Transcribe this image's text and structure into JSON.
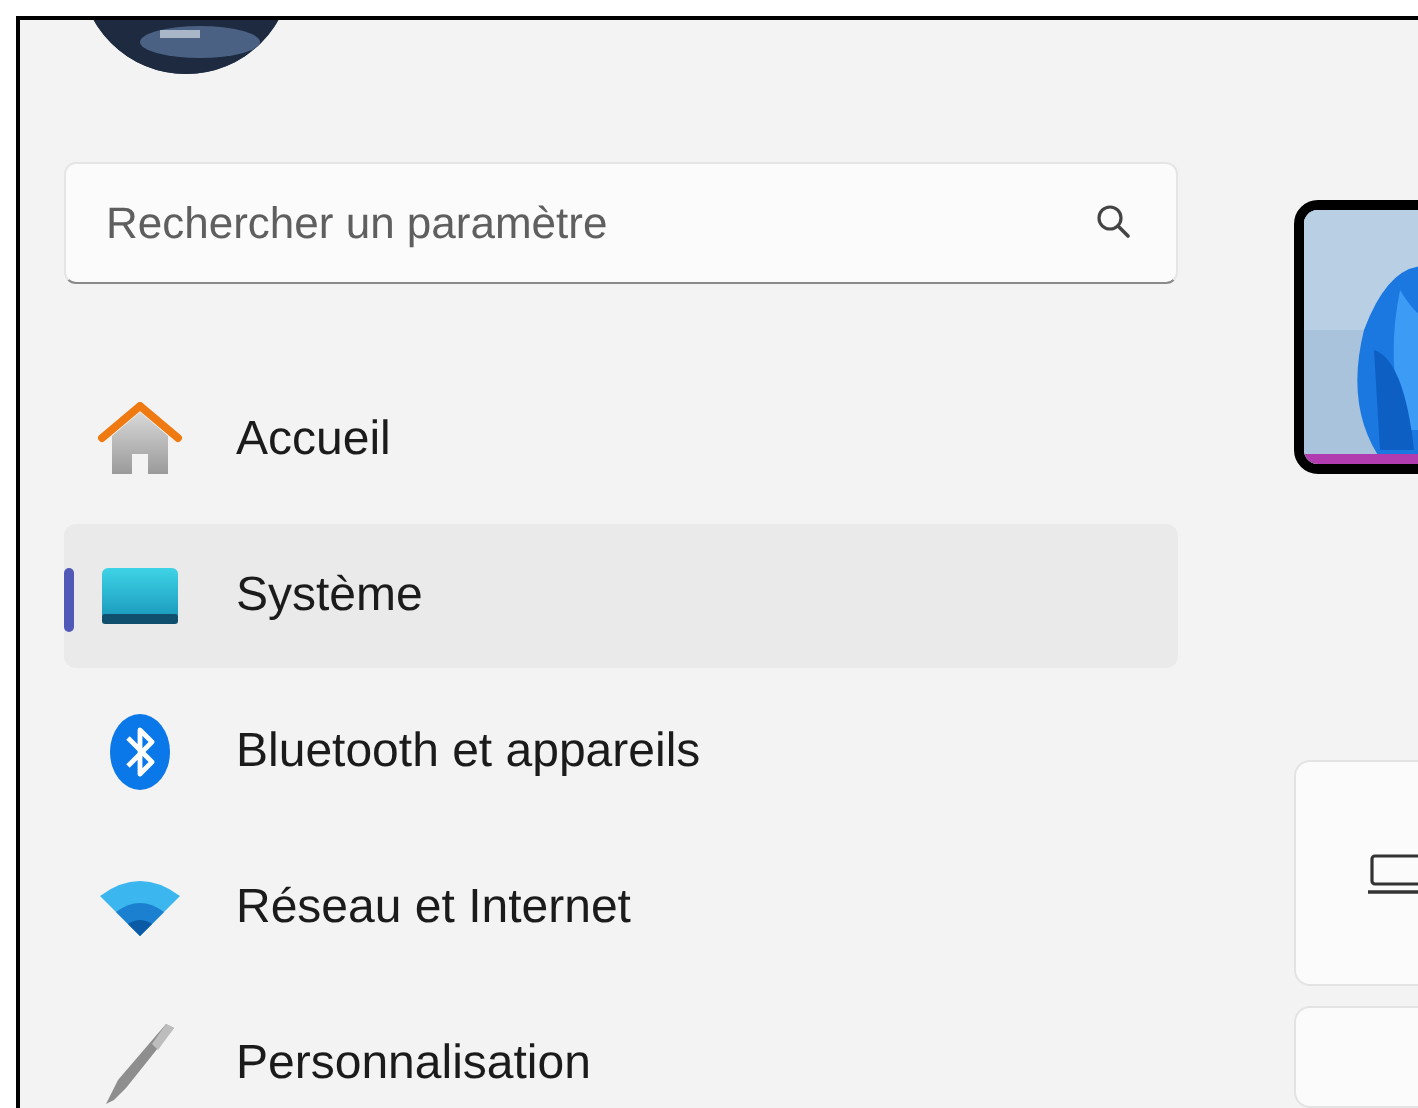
{
  "search": {
    "placeholder": "Rechercher un paramètre"
  },
  "nav_items": [
    {
      "kind": "home",
      "label": "Accueil",
      "selected": false
    },
    {
      "kind": "system",
      "label": "Système",
      "selected": true
    },
    {
      "kind": "bluetooth",
      "label": "Bluetooth et appareils",
      "selected": false
    },
    {
      "kind": "network",
      "label": "Réseau et Internet",
      "selected": false
    },
    {
      "kind": "personalization",
      "label": "Personnalisation",
      "selected": false
    }
  ]
}
